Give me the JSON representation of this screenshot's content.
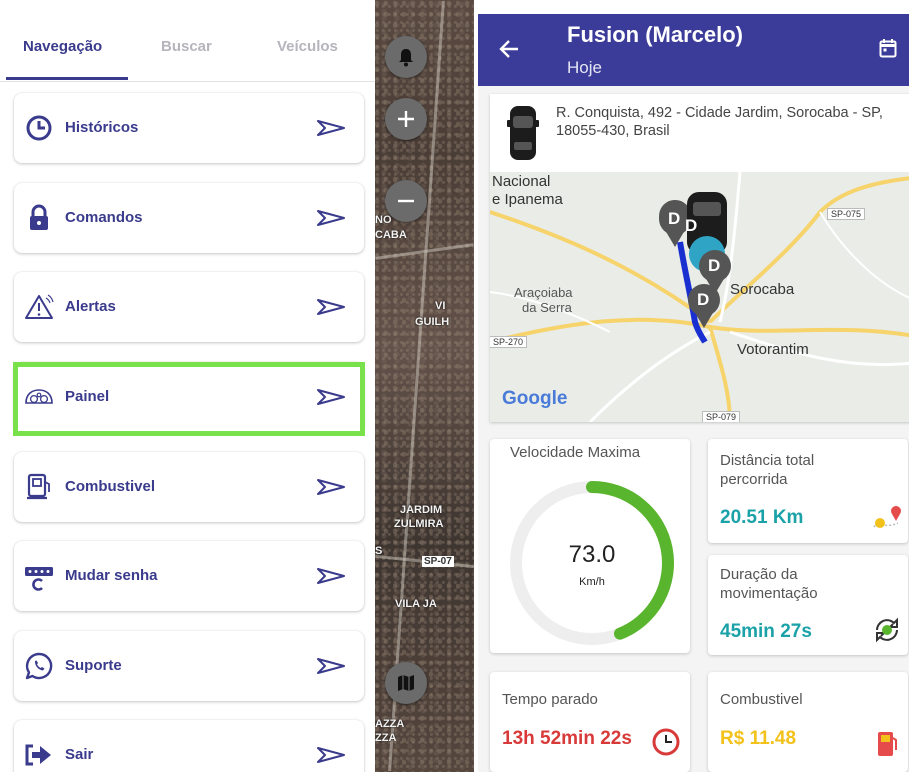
{
  "tabs": [
    {
      "label": "Navegação",
      "active": true
    },
    {
      "label": "Buscar",
      "active": false
    },
    {
      "label": "Veículos",
      "active": false
    }
  ],
  "menu": [
    {
      "label": "Históricos",
      "icon": "clock-icon"
    },
    {
      "label": "Comandos",
      "icon": "lock-icon"
    },
    {
      "label": "Alertas",
      "icon": "alert-icon"
    },
    {
      "label": "Painel",
      "icon": "dashboard-icon",
      "highlighted": true
    },
    {
      "label": "Combustivel",
      "icon": "fuel-pump-icon"
    },
    {
      "label": "Mudar senha",
      "icon": "password-icon"
    },
    {
      "label": "Suporte",
      "icon": "whatsapp-icon"
    },
    {
      "label": "Sair",
      "icon": "logout-icon"
    }
  ],
  "map_strip": {
    "labels": [
      "NO",
      "CABA",
      "VI",
      "GUILH",
      "JARDIM",
      "ZULMIRA",
      "S",
      "SP-07",
      "VILA JA",
      "AZZA",
      "ZZA"
    ]
  },
  "header": {
    "title": "Fusion (Marcelo)",
    "subtitle": "Hoje"
  },
  "address": "R. Conquista, 492 - Cidade Jardim, Sorocaba - SP, 18055-430, Brasil",
  "map": {
    "places": [
      "Nacional",
      "e Ipanema",
      "Araçoiaba",
      "da Serra",
      "Sorocaba",
      "Votorantim"
    ],
    "roads": [
      "SP-075",
      "SP-270",
      "SP-079"
    ],
    "markers": [
      "D",
      "D",
      "D",
      "D"
    ],
    "attribution": "Google"
  },
  "stats": {
    "speed": {
      "title": "Velocidade Maxima",
      "value": "73.0",
      "unit": "Km/h",
      "gauge_fraction": 0.44
    },
    "distance": {
      "title": "Distância total percorrida",
      "value": "20.51 Km"
    },
    "duration": {
      "title": "Duração da movimentação",
      "value": "45min 27s"
    },
    "stopped": {
      "title": "Tempo parado",
      "value": "13h 52min 22s"
    },
    "fuel": {
      "title": "Combustivel",
      "value": "R$ 11.48"
    }
  },
  "colors": {
    "primary": "#3b3c99",
    "nav_text": "#3a3b8c",
    "highlight": "#79e24a",
    "gauge": "#5ab52e",
    "teal": "#1aa2a8",
    "red": "#d83a3a",
    "yellow": "#f2c21b"
  }
}
